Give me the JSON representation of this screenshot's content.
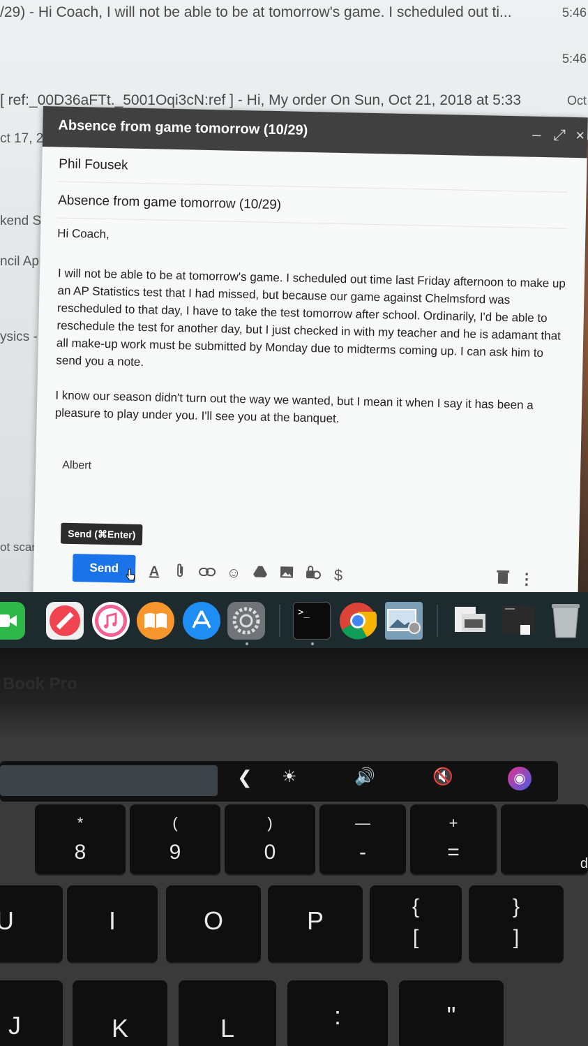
{
  "inbox": {
    "rows": [
      {
        "snippet": "/29) - Hi Coach, I will not be able to be at tomorrow's game. I scheduled out ti...",
        "time": "5:46"
      },
      {
        "snippet": "",
        "time": "5:46"
      },
      {
        "snippet": "[ ref:_00D36aFTt._5001Oqi3cN:ref ] - Hi, My order On Sun, Oct 21, 2018 at 5:33",
        "time": "Oct"
      }
    ],
    "side_fragments": [
      "ct 17, 2",
      "kend Sat",
      "ncil Appli",
      "ysics - Hi",
      "ot scammed"
    ]
  },
  "compose": {
    "title": "Absence from game tomorrow (10/29)",
    "to": "Phil Fousek",
    "subject": "Absence from game tomorrow (10/29)",
    "greeting": "Hi Coach,",
    "paragraph1": "I will not be able to be at tomorrow's game. I scheduled out time last Friday afternoon to make up an AP Statistics test that I had missed, but because our game against Chelmsford was rescheduled to that day, I have to take the test tomorrow after school. Ordinarily, I'd be able to reschedule the test for another day, but I just checked in with my teacher and he is adamant that all make-up work must be submitted by Monday due to midterms coming up. I can ask him to send you a note.",
    "paragraph2": "I know our season didn't turn out the way we wanted, but I mean it when I say it has been a pleasure to play under you. I'll see you at the banquet.",
    "signature": "Albert",
    "send_tooltip": "Send (⌘Enter)",
    "send_label": "Send",
    "header_icons": {
      "minimize": "–",
      "expand": "⤢",
      "close": "×"
    },
    "toolbar_icons": [
      "formatting-icon",
      "attach-icon",
      "link-icon",
      "emoji-icon",
      "drive-icon",
      "photo-icon",
      "confidential-icon",
      "money-icon"
    ]
  },
  "dock": {
    "apps": [
      "facetime",
      "news",
      "itunes",
      "ibooks",
      "app-store",
      "system-preferences",
      "terminal",
      "chrome",
      "preview",
      "documents",
      "downloads",
      "trash"
    ],
    "terminal_prompt": ">_"
  },
  "laptop": {
    "model_label": "Book Pro"
  },
  "touch_bar": {
    "back": "❮",
    "brightness": "☀",
    "volume": "🔊",
    "mute": "🔇",
    "siri": "◉"
  },
  "keys": {
    "k8": {
      "top": "*",
      "bottom": "8"
    },
    "k9": {
      "top": "(",
      "bottom": "9"
    },
    "k0": {
      "top": ")",
      "bottom": "0"
    },
    "kminus": {
      "top": "—",
      "bottom": "-"
    },
    "kplus": {
      "top": "+",
      "bottom": "="
    },
    "kd": {
      "label": "d"
    },
    "kU": {
      "label": "U"
    },
    "kI": {
      "label": "I"
    },
    "kO": {
      "label": "O"
    },
    "kP": {
      "label": "P"
    },
    "kbrl": {
      "top": "{",
      "bottom": "["
    },
    "kbrr": {
      "top": "}",
      "bottom": "]"
    },
    "kJ": {
      "label": "J"
    },
    "kK": {
      "label": "K"
    },
    "kL": {
      "label": "L"
    },
    "kcolon": {
      "label": ":"
    },
    "kquote": {
      "label": "\""
    }
  },
  "colors": {
    "send_button": "#1a73e8",
    "compose_header": "#404040"
  }
}
